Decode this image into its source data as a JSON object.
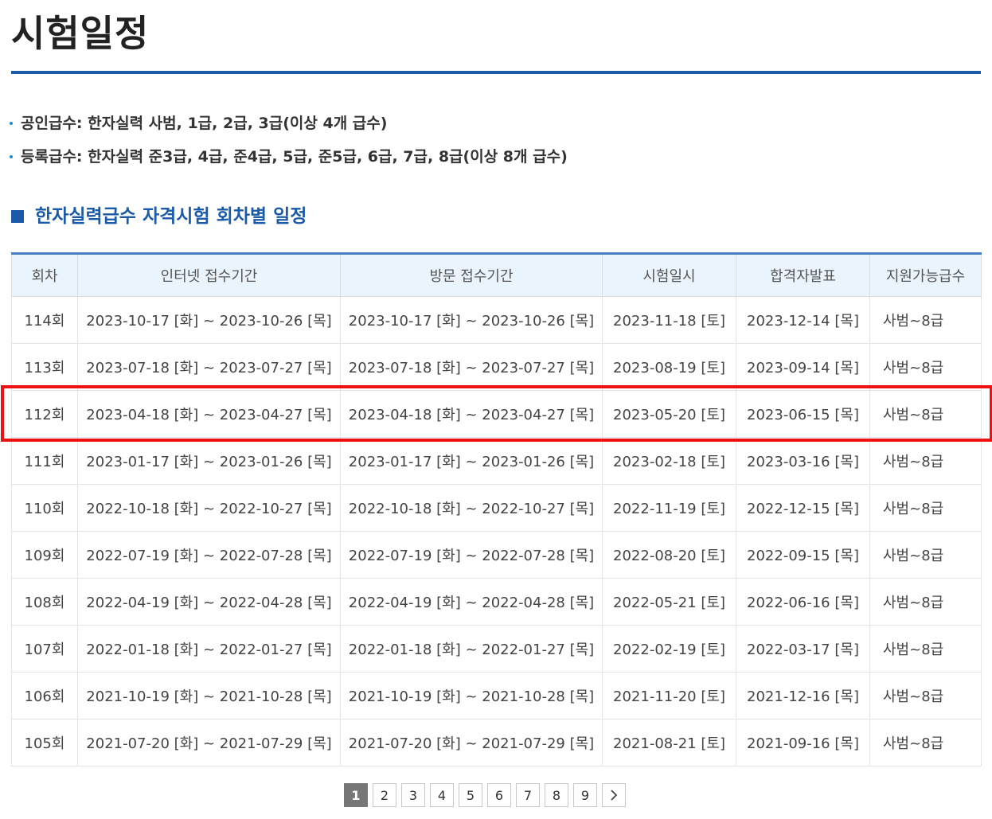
{
  "page": {
    "title": "시험일정"
  },
  "grades": [
    {
      "text": "공인급수: 한자실력 사범, 1급, 2급, 3급(이상 4개 급수)"
    },
    {
      "text": "등록급수: 한자실력 준3급, 4급, 준4급, 5급, 준5급, 6급, 7급, 8급(이상 8개 급수)"
    }
  ],
  "section": {
    "title": "한자실력급수 자격시험 회차별 일정"
  },
  "table": {
    "headers": [
      "회차",
      "인터넷 접수기간",
      "방문 접수기간",
      "시험일시",
      "합격자발표",
      "지원가능급수"
    ],
    "rows": [
      [
        "114회",
        "2023-10-17 [화] ~ 2023-10-26 [목]",
        "2023-10-17 [화] ~ 2023-10-26 [목]",
        "2023-11-18 [토]",
        "2023-12-14 [목]",
        "사범~8급"
      ],
      [
        "113회",
        "2023-07-18 [화] ~ 2023-07-27 [목]",
        "2023-07-18 [화] ~ 2023-07-27 [목]",
        "2023-08-19 [토]",
        "2023-09-14 [목]",
        "사범~8급"
      ],
      [
        "112회",
        "2023-04-18 [화] ~ 2023-04-27 [목]",
        "2023-04-18 [화] ~ 2023-04-27 [목]",
        "2023-05-20 [토]",
        "2023-06-15 [목]",
        "사범~8급"
      ],
      [
        "111회",
        "2023-01-17 [화] ~ 2023-01-26 [목]",
        "2023-01-17 [화] ~ 2023-01-26 [목]",
        "2023-02-18 [토]",
        "2023-03-16 [목]",
        "사범~8급"
      ],
      [
        "110회",
        "2022-10-18 [화] ~ 2022-10-27 [목]",
        "2022-10-18 [화] ~ 2022-10-27 [목]",
        "2022-11-19 [토]",
        "2022-12-15 [목]",
        "사범~8급"
      ],
      [
        "109회",
        "2022-07-19 [화] ~ 2022-07-28 [목]",
        "2022-07-19 [화] ~ 2022-07-28 [목]",
        "2022-08-20 [토]",
        "2022-09-15 [목]",
        "사범~8급"
      ],
      [
        "108회",
        "2022-04-19 [화] ~ 2022-04-28 [목]",
        "2022-04-19 [화] ~ 2022-04-28 [목]",
        "2022-05-21 [토]",
        "2022-06-16 [목]",
        "사범~8급"
      ],
      [
        "107회",
        "2022-01-18 [화] ~ 2022-01-27 [목]",
        "2022-01-18 [화] ~ 2022-01-27 [목]",
        "2022-02-19 [토]",
        "2022-03-17 [목]",
        "사범~8급"
      ],
      [
        "106회",
        "2021-10-19 [화] ~ 2021-10-28 [목]",
        "2021-10-19 [화] ~ 2021-10-28 [목]",
        "2021-11-20 [토]",
        "2021-12-16 [목]",
        "사범~8급"
      ],
      [
        "105회",
        "2021-07-20 [화] ~ 2021-07-29 [목]",
        "2021-07-20 [화] ~ 2021-07-29 [목]",
        "2021-08-21 [토]",
        "2021-09-16 [목]",
        "사범~8급"
      ]
    ],
    "highlighted_round": "112회"
  },
  "pagination": {
    "pages": [
      "1",
      "2",
      "3",
      "4",
      "5",
      "6",
      "7",
      "8",
      "9"
    ],
    "current": "1",
    "next_icon": "chevron-right-icon"
  },
  "colors": {
    "accent": "#1a5aa8",
    "header_bg": "#e9f4fc",
    "highlight": "#ee1111",
    "active_page": "#777777"
  }
}
